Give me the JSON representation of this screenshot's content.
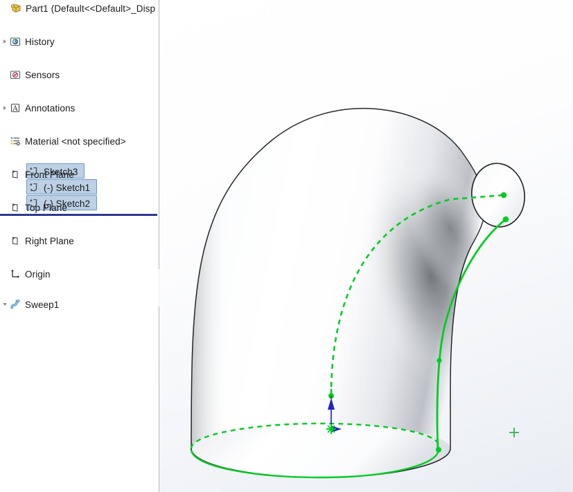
{
  "app": {
    "title": "Part1  (Default<<Default>_Disp"
  },
  "feature_tree": {
    "name": "FeatureManager design tree",
    "items": [
      {
        "label": "Part1  (Default<<Default>_Disp",
        "icon": "part-box-icon",
        "twisty": "none",
        "level": 0,
        "selected": false
      },
      {
        "label": "History",
        "icon": "history-icon",
        "twisty": "right",
        "level": 1,
        "selected": false
      },
      {
        "label": "Sensors",
        "icon": "sensors-icon",
        "twisty": "none",
        "level": 1,
        "selected": false
      },
      {
        "label": "Annotations",
        "icon": "annotations-icon",
        "twisty": "right",
        "level": 1,
        "selected": false
      },
      {
        "label": "Material <not specified>",
        "icon": "material-icon",
        "twisty": "none",
        "level": 1,
        "selected": false
      },
      {
        "label": "Front Plane",
        "icon": "plane-icon",
        "twisty": "none",
        "level": 1,
        "selected": false
      },
      {
        "label": "Top Plane",
        "icon": "plane-icon",
        "twisty": "none",
        "level": 1,
        "selected": false
      },
      {
        "label": "Right Plane",
        "icon": "plane-icon",
        "twisty": "none",
        "level": 1,
        "selected": false
      },
      {
        "label": "Origin",
        "icon": "origin-axes-icon",
        "twisty": "none",
        "level": 1,
        "selected": false
      },
      {
        "label": "Sweep1",
        "icon": "sweep-feature-icon",
        "twisty": "down",
        "level": 1,
        "selected": false
      },
      {
        "label": "Sketch3",
        "icon": "sketch-icon",
        "twisty": "none",
        "level": 2,
        "selected": true
      },
      {
        "label": "(-) Sketch1",
        "icon": "sketch-icon",
        "twisty": "none",
        "level": 2,
        "selected": true
      },
      {
        "label": "(-) Sketch2",
        "icon": "sketch-icon",
        "twisty": "none",
        "level": 2,
        "selected": true
      }
    ]
  },
  "rollback_bar": {
    "name": "rollback-bar"
  },
  "splitter": {
    "name": "panel-splitter-handle"
  },
  "graphics_area": {
    "name": "3d-graphics-viewport",
    "model": "swept elbow / 90 degree pipe bend",
    "colors": {
      "sketch_green": "#00cc22",
      "edge_black": "#1a1a1a",
      "axis_blue": "#2222cc",
      "background_top": "#ffffff",
      "background_bottom": "#e9edf3"
    },
    "entities": [
      {
        "name": "sweep-body",
        "type": "shaded-solid"
      },
      {
        "name": "profile-circle",
        "type": "circle-edge"
      },
      {
        "name": "sweep-path-curve",
        "type": "green-dashed-arc"
      },
      {
        "name": "guide-curve",
        "type": "green-solid-curve"
      },
      {
        "name": "bottom-face-ellipse",
        "type": "green-arc"
      },
      {
        "name": "origin-triad",
        "type": "origin-marker"
      },
      {
        "name": "sketch-point-marker",
        "type": "green-crosshair"
      }
    ]
  }
}
